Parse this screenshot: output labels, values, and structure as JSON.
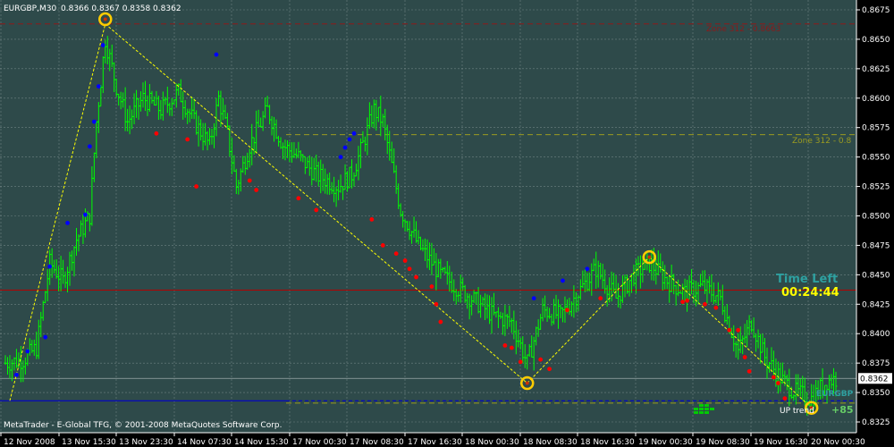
{
  "header": {
    "symbol_tf": "EURGBP,M30",
    "ohlc": "0.8366 0.8367 0.8358 0.8362"
  },
  "footer": {
    "copyright": "MetaTrader - E-Global TFG, © 2001-2008 MetaQuotes Software Corp."
  },
  "panel": {
    "time_left_label": "Time Left",
    "time_left_value": "00:24:44",
    "symbol_badge": "EURGBP",
    "up_label": "UP trend",
    "up_value": "+85"
  },
  "colors": {
    "background": "#2e4a4a",
    "grid": "#8a9a9a",
    "bars": "#00ff00",
    "zigzag": "#ffff00",
    "up_arrow": "#0000ff",
    "down_arrow": "#ff0000",
    "resistance_line": "#b40000",
    "support_line": "#0000c8",
    "zone_upper": "#8b1a1a",
    "zone_mid": "#9b9b20",
    "time_left_label": "#2ea0a0",
    "time_left_value": "#ffff00"
  },
  "chart_data": {
    "type": "ohlc",
    "symbol": "EURGBP",
    "timeframe": "M30",
    "ylim": [
      0.8325,
      0.8675
    ],
    "y_ticks": [
      "0.8675",
      "0.8650",
      "0.8625",
      "0.8600",
      "0.8575",
      "0.8550",
      "0.8525",
      "0.8500",
      "0.8475",
      "0.8450",
      "0.8425",
      "0.8400",
      "0.8375",
      "0.8350",
      "0.8325"
    ],
    "x_ticks": [
      "12 Nov 2008",
      "13 Nov 15:30",
      "13 Nov 23:30",
      "14 Nov 07:30",
      "14 Nov 15:30",
      "17 Nov 00:30",
      "17 Nov 08:30",
      "17 Nov 16:30",
      "18 Nov 00:30",
      "18 Nov 08:30",
      "18 Nov 16:30",
      "19 Nov 00:30",
      "19 Nov 08:30",
      "19 Nov 16:30",
      "20 Nov 00:30"
    ],
    "current_price": "0.8362",
    "zones": [
      {
        "label": "Zone 312 - 0.8663",
        "price": 0.8663
      },
      {
        "label": "Zone 312 - 0.8",
        "price": 0.8569
      }
    ],
    "levels": [
      {
        "name": "resistance",
        "price": 0.8437
      },
      {
        "name": "support",
        "price": 0.8343
      }
    ],
    "zigzag": [
      {
        "bar": 2,
        "price": 0.8343
      },
      {
        "bar": 45,
        "price": 0.8663
      },
      {
        "bar": 235,
        "price": 0.8358
      },
      {
        "bar": 290,
        "price": 0.8465
      },
      {
        "bar": 363,
        "price": 0.8337
      }
    ],
    "swing_circles": [
      {
        "bar": 45,
        "price": 0.8667
      },
      {
        "bar": 235,
        "price": 0.8358
      },
      {
        "bar": 290,
        "price": 0.8465
      },
      {
        "bar": 363,
        "price": 0.8337
      }
    ],
    "bar_count": 375,
    "close_anchors": [
      [
        0,
        0.8375
      ],
      [
        8,
        0.8378
      ],
      [
        14,
        0.8388
      ],
      [
        20,
        0.846
      ],
      [
        26,
        0.8445
      ],
      [
        32,
        0.848
      ],
      [
        38,
        0.85
      ],
      [
        41,
        0.858
      ],
      [
        45,
        0.865
      ],
      [
        50,
        0.861
      ],
      [
        55,
        0.858
      ],
      [
        62,
        0.86
      ],
      [
        70,
        0.859
      ],
      [
        78,
        0.8605
      ],
      [
        85,
        0.858
      ],
      [
        92,
        0.856
      ],
      [
        96,
        0.86
      ],
      [
        100,
        0.857
      ],
      [
        104,
        0.8525
      ],
      [
        110,
        0.856
      ],
      [
        118,
        0.859
      ],
      [
        125,
        0.856
      ],
      [
        132,
        0.855
      ],
      [
        140,
        0.8535
      ],
      [
        150,
        0.8525
      ],
      [
        156,
        0.8535
      ],
      [
        160,
        0.8555
      ],
      [
        166,
        0.859
      ],
      [
        170,
        0.858
      ],
      [
        178,
        0.8505
      ],
      [
        186,
        0.8475
      ],
      [
        196,
        0.845
      ],
      [
        210,
        0.843
      ],
      [
        220,
        0.8415
      ],
      [
        228,
        0.841
      ],
      [
        235,
        0.8375
      ],
      [
        242,
        0.842
      ],
      [
        250,
        0.8415
      ],
      [
        258,
        0.8435
      ],
      [
        266,
        0.8455
      ],
      [
        275,
        0.843
      ],
      [
        283,
        0.845
      ],
      [
        290,
        0.846
      ],
      [
        298,
        0.8445
      ],
      [
        306,
        0.8435
      ],
      [
        314,
        0.844
      ],
      [
        322,
        0.843
      ],
      [
        330,
        0.8385
      ],
      [
        336,
        0.841
      ],
      [
        342,
        0.838
      ],
      [
        350,
        0.836
      ],
      [
        356,
        0.835
      ],
      [
        363,
        0.8345
      ],
      [
        370,
        0.836
      ],
      [
        375,
        0.8362
      ]
    ],
    "up_arrows": [
      [
        5,
        0.8365
      ],
      [
        10,
        0.8385
      ],
      [
        18,
        0.8397
      ],
      [
        20,
        0.8457
      ],
      [
        28,
        0.8494
      ],
      [
        36,
        0.8501
      ],
      [
        38,
        0.8559
      ],
      [
        40,
        0.858
      ],
      [
        42,
        0.861
      ],
      [
        44,
        0.8645
      ],
      [
        95,
        0.8637
      ],
      [
        151,
        0.855
      ],
      [
        153,
        0.8558
      ],
      [
        155,
        0.8565
      ],
      [
        157,
        0.857
      ],
      [
        238,
        0.843
      ],
      [
        251,
        0.8445
      ],
      [
        262,
        0.8455
      ]
    ],
    "down_arrows": [
      [
        68,
        0.857
      ],
      [
        82,
        0.8565
      ],
      [
        86,
        0.8525
      ],
      [
        110,
        0.853
      ],
      [
        113,
        0.8522
      ],
      [
        132,
        0.8515
      ],
      [
        140,
        0.8505
      ],
      [
        165,
        0.8497
      ],
      [
        170,
        0.8475
      ],
      [
        176,
        0.8468
      ],
      [
        180,
        0.8462
      ],
      [
        182,
        0.8455
      ],
      [
        185,
        0.8448
      ],
      [
        192,
        0.844
      ],
      [
        194,
        0.8425
      ],
      [
        196,
        0.841
      ],
      [
        225,
        0.839
      ],
      [
        228,
        0.8388
      ],
      [
        232,
        0.8376
      ],
      [
        241,
        0.8378
      ],
      [
        245,
        0.837
      ],
      [
        253,
        0.842
      ],
      [
        268,
        0.843
      ],
      [
        305,
        0.8427
      ],
      [
        307,
        0.8428
      ],
      [
        315,
        0.8425
      ],
      [
        320,
        0.8422
      ],
      [
        326,
        0.8403
      ],
      [
        330,
        0.8403
      ],
      [
        333,
        0.838
      ],
      [
        335,
        0.8368
      ],
      [
        346,
        0.8363
      ],
      [
        348,
        0.8358
      ],
      [
        351,
        0.8345
      ]
    ]
  }
}
